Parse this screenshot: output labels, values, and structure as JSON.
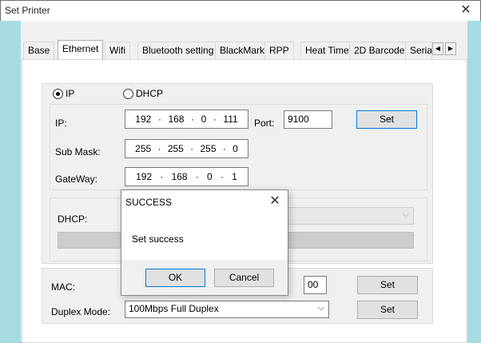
{
  "window": {
    "title": "Set Printer",
    "close_symbol": "✕"
  },
  "tabs": [
    {
      "label": "Base"
    },
    {
      "label": "Ethernet"
    },
    {
      "label": "Wifi"
    },
    {
      "label": "Bluetooth setting"
    },
    {
      "label": "BlackMark"
    },
    {
      "label": "RPP"
    },
    {
      "label": "Heat Time"
    },
    {
      "label": "2D Barcode"
    },
    {
      "label": "Serial"
    }
  ],
  "tab_scroll": {
    "left": "◀",
    "right": "▶"
  },
  "mode": {
    "ip_label": "IP",
    "dhcp_label": "DHCP",
    "selected": "IP"
  },
  "ip": {
    "label": "IP:",
    "octets": [
      "192",
      "168",
      "0",
      "111"
    ],
    "port_label": "Port:",
    "port": "9100",
    "set_label": "Set"
  },
  "submask": {
    "label": "Sub Mask:",
    "octets": [
      "255",
      "255",
      "255",
      "0"
    ]
  },
  "gateway": {
    "label": "GateWay:",
    "octets": [
      "192",
      "168",
      "0",
      "1"
    ]
  },
  "dhcp": {
    "label": "DHCP:"
  },
  "mac": {
    "label": "MAC:",
    "value_tail": "00",
    "set_label": "Set"
  },
  "duplex": {
    "label": "Duplex Mode:",
    "value": "100Mbps Full Duplex",
    "set_label": "Set"
  },
  "dialog": {
    "title": "SUCCESS",
    "close_symbol": "✕",
    "message": "Set success",
    "ok_label": "OK",
    "cancel_label": "Cancel"
  },
  "icons": {
    "chevron": "⌵",
    "dot": "·"
  }
}
